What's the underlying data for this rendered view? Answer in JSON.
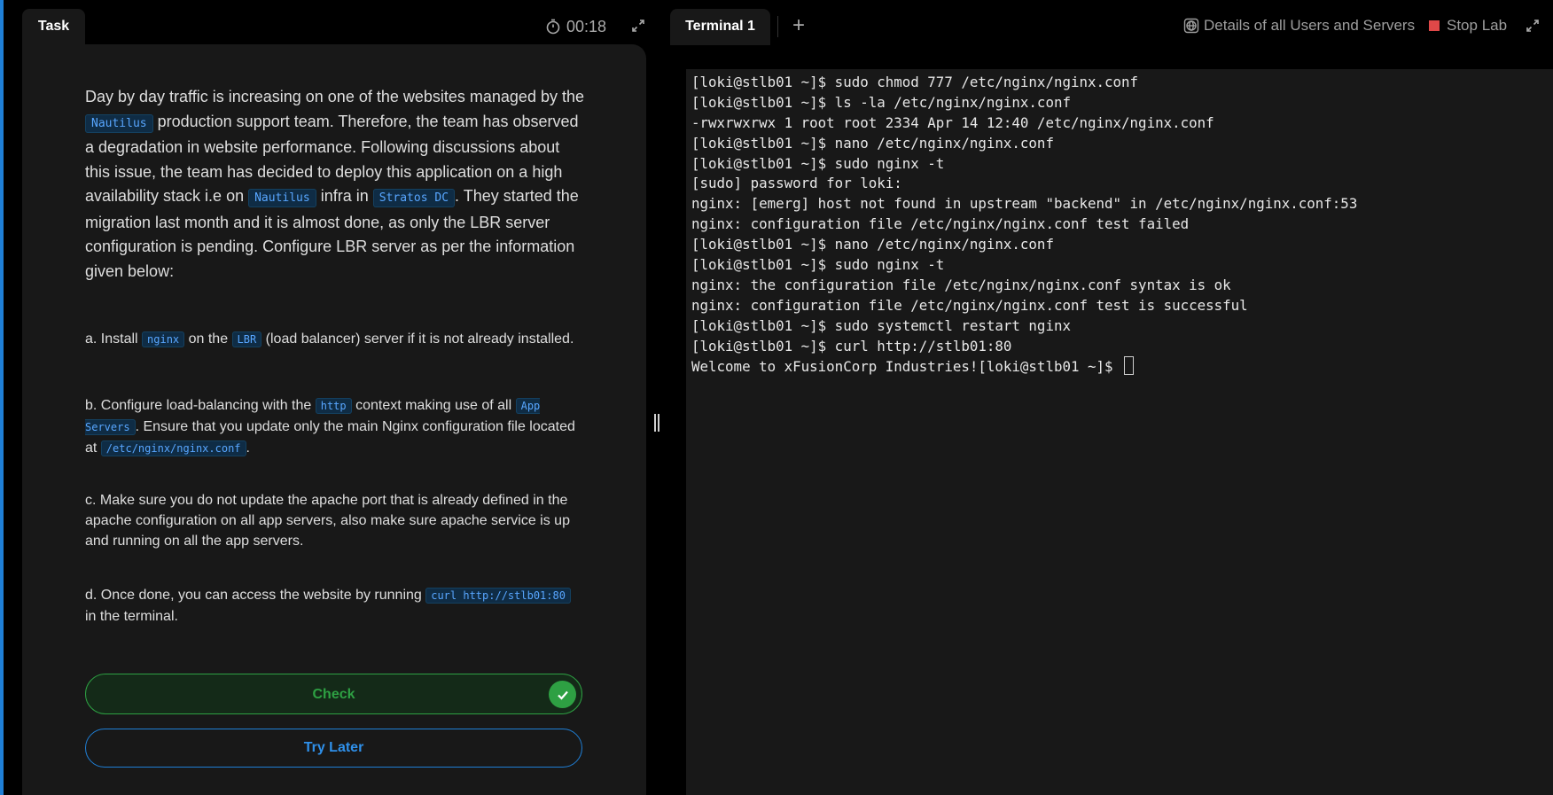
{
  "task": {
    "tab_label": "Task",
    "timer": "00:18",
    "intro": [
      {
        "t": "Day by day traffic is increasing on one of the websites managed by the "
      },
      {
        "c": "Nautilus"
      },
      {
        "t": " production support team. Therefore, the team has observed a degradation in website performance. Following discussions about this issue, the team has decided to deploy this application on a high availability stack i.e on "
      },
      {
        "c": "Nautilus"
      },
      {
        "t": " infra in "
      },
      {
        "c": "Stratos DC"
      },
      {
        "t": ". They started the migration last month and it is almost done, as only the LBR server configuration is pending. Configure LBR server as per the information given below:"
      }
    ],
    "steps": [
      [
        {
          "t": "a. Install "
        },
        {
          "c": "nginx"
        },
        {
          "t": " on the "
        },
        {
          "c": "LBR"
        },
        {
          "t": " (load balancer) server if it is not already installed."
        }
      ],
      [
        {
          "t": "b. Configure load-balancing with the "
        },
        {
          "c": "http"
        },
        {
          "t": " context making use of all "
        },
        {
          "c": "App Servers"
        },
        {
          "t": ". Ensure that you update only the main Nginx configuration file located at "
        },
        {
          "c": "/etc/nginx/nginx.conf"
        },
        {
          "t": "."
        }
      ],
      [
        {
          "t": "c. Make sure you do not update the apache port that is already defined in the apache configuration on all app servers, also make sure apache service is up and running on all the app servers."
        }
      ],
      [
        {
          "t": "d. Once done, you can access the website by running "
        },
        {
          "c": "curl http://stlb01:80"
        },
        {
          "t": " in the terminal."
        }
      ]
    ],
    "check_label": "Check",
    "try_later_label": "Try Later"
  },
  "terminal": {
    "tab_label": "Terminal 1",
    "add_tab_label": "+",
    "details_label": "Details of all Users and Servers",
    "stop_label": "Stop Lab",
    "lines": [
      "[loki@stlb01 ~]$ sudo chmod 777 /etc/nginx/nginx.conf",
      "[loki@stlb01 ~]$ ls -la /etc/nginx/nginx.conf",
      "-rwxrwxrwx 1 root root 2334 Apr 14 12:40 /etc/nginx/nginx.conf",
      "[loki@stlb01 ~]$ nano /etc/nginx/nginx.conf",
      "[loki@stlb01 ~]$ sudo nginx -t",
      "[sudo] password for loki:",
      "nginx: [emerg] host not found in upstream \"backend\" in /etc/nginx/nginx.conf:53",
      "nginx: configuration file /etc/nginx/nginx.conf test failed",
      "[loki@stlb01 ~]$ nano /etc/nginx/nginx.conf",
      "[loki@stlb01 ~]$ sudo nginx -t",
      "nginx: the configuration file /etc/nginx/nginx.conf syntax is ok",
      "nginx: configuration file /etc/nginx/nginx.conf test is successful",
      "[loki@stlb01 ~]$ sudo systemctl restart nginx",
      "[loki@stlb01 ~]$ curl http://stlb01:80",
      "Welcome to xFusionCorp Industries![loki@stlb01 ~]$ "
    ]
  },
  "icons": {
    "timer": "stopwatch-icon",
    "expand": "expand-icon",
    "details": "globe-icon",
    "stop": "stop-square-icon",
    "check_status": "checkmark-circle-icon"
  },
  "colors": {
    "accent_blue": "#1f7fd6",
    "success_green": "#2ea043",
    "stop_red": "#e04848",
    "code_text": "#58a6ff"
  }
}
